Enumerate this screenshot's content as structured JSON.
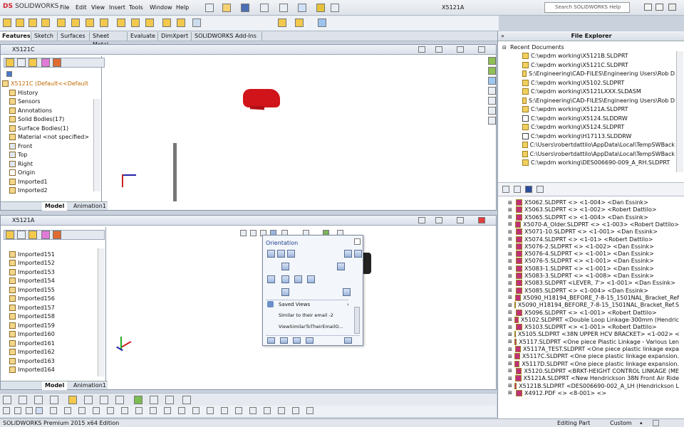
{
  "app": {
    "name_bold": "DS",
    "name": "SOLIDWORKS",
    "doc_title": "X5121A",
    "help_placeholder": "Search SOLIDWORKS Help"
  },
  "menu": [
    "File",
    "Edit",
    "View",
    "Insert",
    "Tools",
    "Window",
    "Help"
  ],
  "command_tabs": [
    "Features",
    "Sketch",
    "Surfaces",
    "Sheet Metal",
    "Evaluate",
    "DimXpert",
    "SOLIDWORKS Add-Ins"
  ],
  "top_view": {
    "title": "X5121C",
    "tree": [
      "X5121C  (Default<<Default",
      "History",
      "Sensors",
      "Annotations",
      "Solid Bodies(17)",
      "Surface Bodies(1)",
      "Material <not specified>",
      "Front",
      "Top",
      "Right",
      "Origin",
      "Imported1",
      "Imported2"
    ],
    "tabs": [
      "Model",
      "Animation1"
    ]
  },
  "bottom_view": {
    "title": "X5121A",
    "tree": [
      "Imported151",
      "Imported152",
      "Imported153",
      "Imported154",
      "Imported155",
      "Imported156",
      "Imported157",
      "Imported158",
      "Imported159",
      "Imported160",
      "Imported161",
      "Imported162",
      "Imported163",
      "Imported164"
    ],
    "tabs": [
      "Model",
      "Animation1"
    ]
  },
  "orientation": {
    "title": "Orientation",
    "saved_views": "Saved Views",
    "items": [
      "Similar to their email -2",
      "ViewSimilarToTheirEmailO..."
    ]
  },
  "file_explorer": {
    "title": "File Explorer",
    "recent_label": "Recent Documents",
    "recent": [
      "C:\\wpdm working\\X5121B.SLDPRT",
      "C:\\wpdm working\\X5121C.SLDPRT",
      "S:\\Engineering\\CAD-FILES\\Engineering Users\\Rob D",
      "C:\\wpdm working\\X5102.SLDPRT",
      "C:\\wpdm working\\X5121LXXX.SLDASM",
      "S:\\Engineering\\CAD-FILES\\Engineering Users\\Rob D",
      "C:\\wpdm working\\X5121A.SLDPRT",
      "C:\\wpdm working\\X5124.SLDDRW",
      "C:\\wpdm working\\X5124.SLDPRT",
      "C:\\wpdm working\\H17113.SLDDRW",
      "C:\\Users\\robertdattilo\\AppData\\Local\\TempSWBack",
      "C:\\Users\\robertdattilo\\AppData\\Local\\TempSWBack",
      "C:\\wpdm working\\DES006690-009_A_RH.SLDPRT"
    ],
    "vault": [
      "X5062.SLDPRT <> <1-004> <Dan Essink>",
      "X5063.SLDPRT <> <1-002> <Robert Dattilo>",
      "X5065.SLDPRT <> <1-004> <Dan Essink>",
      "X5070-A_Older.SLDPRT <> <1-003> <Robert Dattilo>",
      "X5071-10.SLDPRT <> <1-001> <Dan Essink>",
      "X5074.SLDPRT <> <1-01> <Robert Dattilo>",
      "X5076-2.SLDPRT <> <1-002> <Dan Essink>",
      "X5076-4.SLDPRT <> <1-001> <Dan Essink>",
      "X5076-5.SLDPRT <> <1-001> <Dan Essink>",
      "X5083-1.SLDPRT <> <1-001> <Dan Essink>",
      "X5083-3.SLDPRT <> <1-008> <Dan Essink>",
      "X5083.SLDPRT <LEVER, 7'> <1-001> <Dan Essink>",
      "X5085.SLDPRT <> <1-004> <Dan Essink>",
      "X5090_H18194_BEFORE_7-8-15_1501NAL_Bracket_Ref",
      "X5090_H18194_BEFORE_7-8-15_1501NAL_Bracket_Ref.S",
      "X5096.SLDPRT <> <1-001> <Robert Dattilo>",
      "X5102.SLDPRT <Double Loop Linkage-300mm (Hendric",
      "X5103.SLDPRT <> <1-001> <Robert Dattilo>",
      "X5105.SLDPRT <38N UPPER HCV BRACKET> <1-002> <",
      "X5117.SLDPRT <One piece Plastic Linkage - Various Len",
      "X5117A_TEST.SLDPRT <One piece plastic linkage expa",
      "X5117C.SLDPRT <One piece plastic linkage expansion.",
      "X5117D.SLDPRT <One piece plastic linkage expansion.",
      "X5120.SLDPRT <BRKT-HEIGHT CONTROL LINKAGE (ME",
      "X5121A.SLDPRT <New Hendrickson 38N Front Air Ride",
      "X5121B.SLDPRT <DES006690-002_A_LH (Hendrickson L",
      "X4912.PDF <> <8-001> <>"
    ]
  },
  "status": {
    "left": "SOLIDWORKS Premium 2015 x64 Edition",
    "mode": "Editing Part",
    "units": "Custom"
  },
  "colors": {
    "part_red": "#d0141a",
    "tab_pink": "#c0307a"
  }
}
